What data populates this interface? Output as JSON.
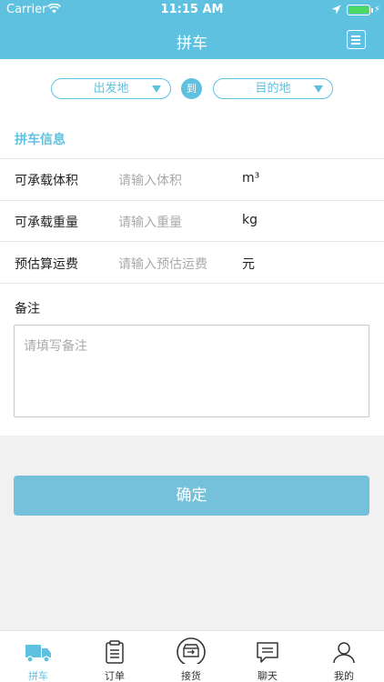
{
  "status_bar": {
    "carrier": "Carrier",
    "time": "11:15 AM"
  },
  "nav": {
    "title": "拼车",
    "menu_icon": "list-icon"
  },
  "route": {
    "from_placeholder": "出发地",
    "to_label": "到",
    "to_placeholder": "目的地"
  },
  "section_title": "拼车信息",
  "rows": [
    {
      "label": "可承载体积",
      "placeholder": "请输入体积",
      "unit": "m³"
    },
    {
      "label": "可承载重量",
      "placeholder": "请输入重量",
      "unit": "kg"
    },
    {
      "label": "预估算运费",
      "placeholder": "请输入预估运费",
      "unit": "元"
    }
  ],
  "remark": {
    "label": "备注",
    "placeholder": "请填写备注"
  },
  "confirm_label": "确定",
  "tabs": [
    {
      "label": "拼车",
      "icon": "truck-icon",
      "active": true
    },
    {
      "label": "订单",
      "icon": "clipboard-icon",
      "active": false
    },
    {
      "label": "接货",
      "icon": "inbox-icon",
      "active": false
    },
    {
      "label": "聊天",
      "icon": "chat-icon",
      "active": false
    },
    {
      "label": "我的",
      "icon": "user-icon",
      "active": false
    }
  ],
  "colors": {
    "accent": "#5fc1e0",
    "button": "#75c1dc",
    "battery": "#4cd964"
  }
}
